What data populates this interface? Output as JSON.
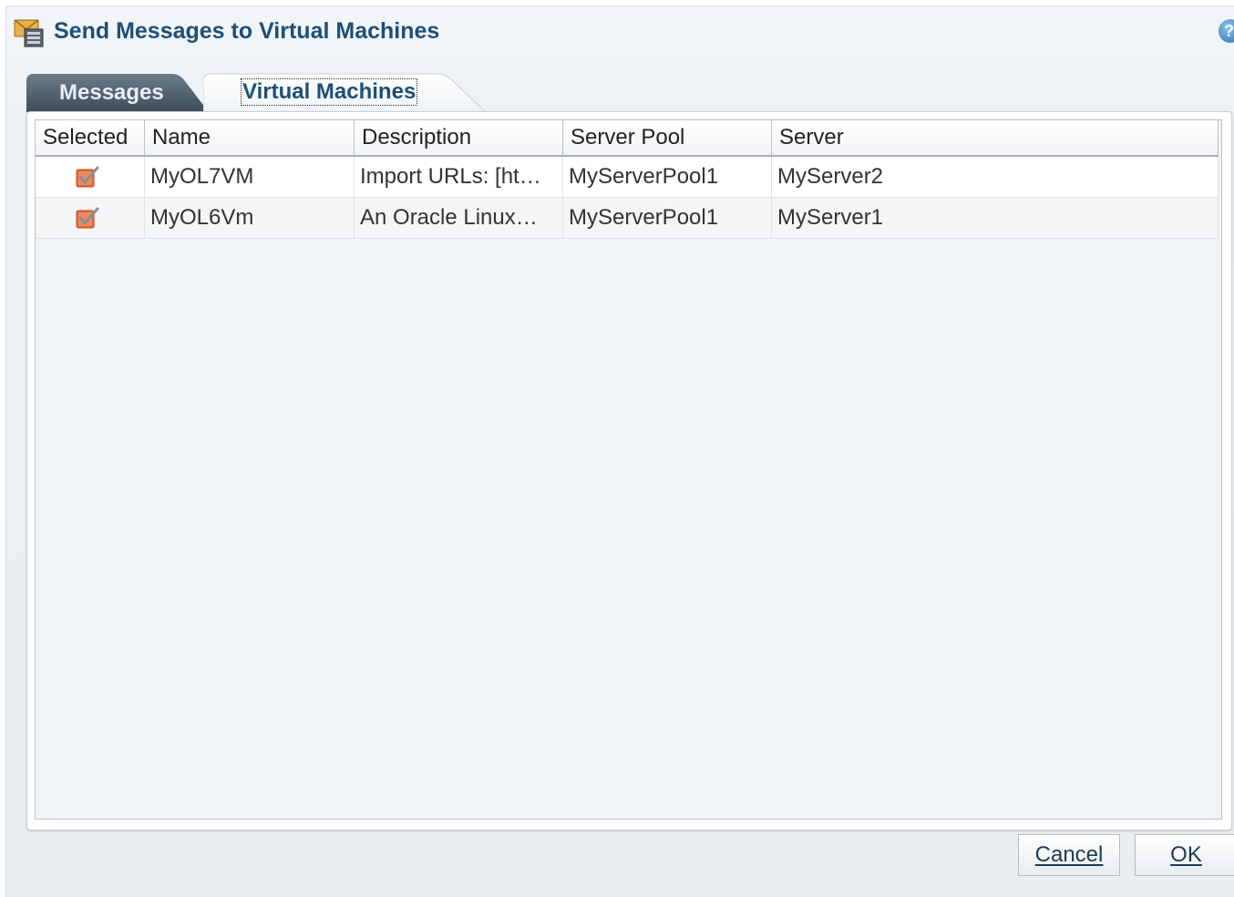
{
  "dialog": {
    "title": "Send Messages to Virtual Machines",
    "help_icon": "question-icon",
    "title_icon": "message-vm-icon",
    "accent_color": "#1d4f78"
  },
  "tabs": [
    {
      "label": "Messages",
      "selected": false
    },
    {
      "label": "Virtual Machines",
      "selected": true
    }
  ],
  "table": {
    "columns": [
      "Selected",
      "Name",
      "Description",
      "Server Pool",
      "Server"
    ],
    "rows": [
      {
        "selected": true,
        "name": "MyOL7VM",
        "description": "Import URLs: [ht…",
        "server_pool": "MyServerPool1",
        "server": "MyServer2"
      },
      {
        "selected": true,
        "name": "MyOL6Vm",
        "description": "An Oracle Linux…",
        "server_pool": "MyServerPool1",
        "server": "MyServer1"
      }
    ],
    "checkbox_color": "#e8673a"
  },
  "buttons": {
    "cancel": "Cancel",
    "ok": "OK"
  }
}
